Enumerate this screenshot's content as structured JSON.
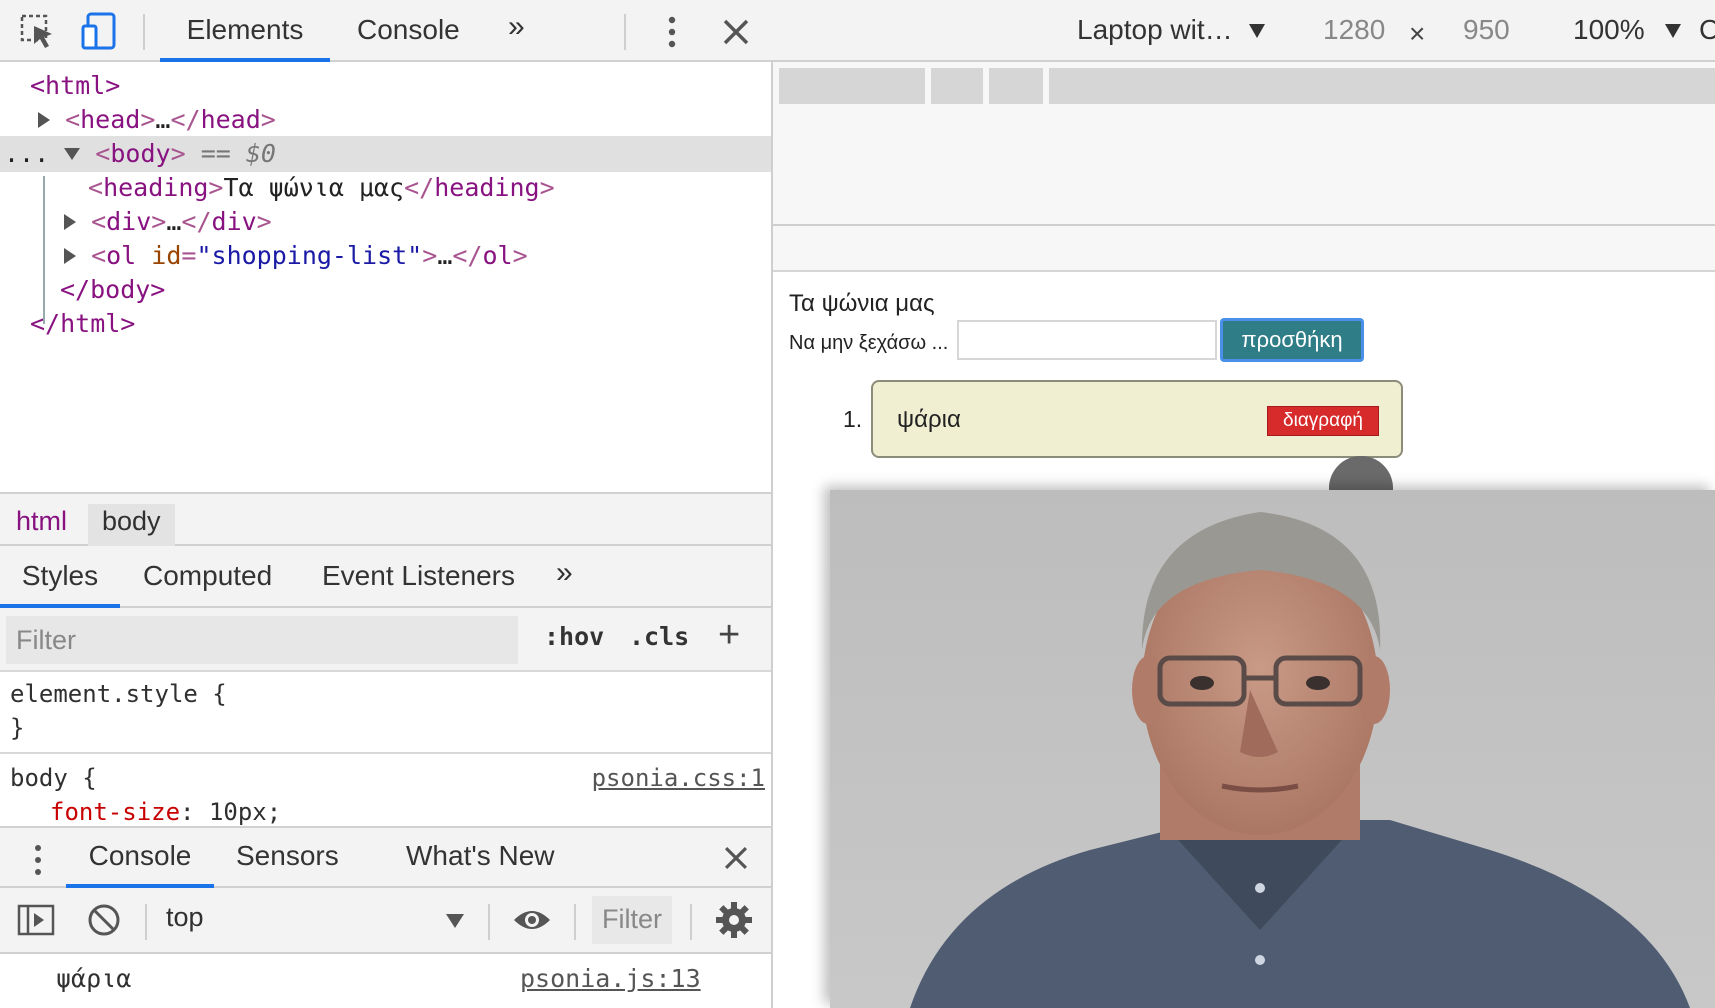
{
  "devtools": {
    "tabs": [
      "Elements",
      "Console"
    ],
    "more": "»",
    "dom": {
      "html_open": "<html>",
      "head": [
        "<",
        "head",
        ">",
        "…",
        "</",
        "head",
        ">"
      ],
      "body_tag": "body",
      "body_eq": "== $0",
      "heading_tag": "heading",
      "heading_text": "Τα ψώνια μας",
      "div_tag": "div",
      "ol_tag": "ol",
      "ol_attr": "id",
      "ol_value": "\"shopping-list\"",
      "ellipsis": "…",
      "dots": "...",
      "body_close": "</body>",
      "html_close": "</html>"
    },
    "breadcrumbs": [
      "html",
      "body"
    ],
    "style_tabs": [
      "Styles",
      "Computed",
      "Event Listeners"
    ],
    "filter_placeholder": "Filter",
    "hov": ":hov",
    "cls": ".cls",
    "plus": "+",
    "styles": {
      "element_style": "element.style {",
      "close_brace": "}",
      "body_selector": "body {",
      "source": "psonia.css:1",
      "property": "font-size",
      "value": "10px;"
    },
    "drawer_tabs": [
      "Console",
      "Sensors",
      "What's New"
    ],
    "context": "top",
    "console_filter": "Filter",
    "log": {
      "text": "ψάρια",
      "source": "psonia.js:13"
    }
  },
  "device": {
    "name": "Laptop wit…",
    "width": "1280",
    "times": "×",
    "height": "950",
    "zoom": "100%",
    "cut": "C"
  },
  "page": {
    "heading": "Τα ψώνια μας",
    "label": "Να μην ξεχάσω ...",
    "input_value": "",
    "add_button": "προσθήκη",
    "items": [
      {
        "number": "1.",
        "text": "ψάρια",
        "delete": "διαγραφή"
      }
    ]
  },
  "colors": {
    "accent": "#1a73e8",
    "add_button": "#2f7d86",
    "delete_button": "#d72a2a",
    "item_bg": "#f1efd2"
  }
}
